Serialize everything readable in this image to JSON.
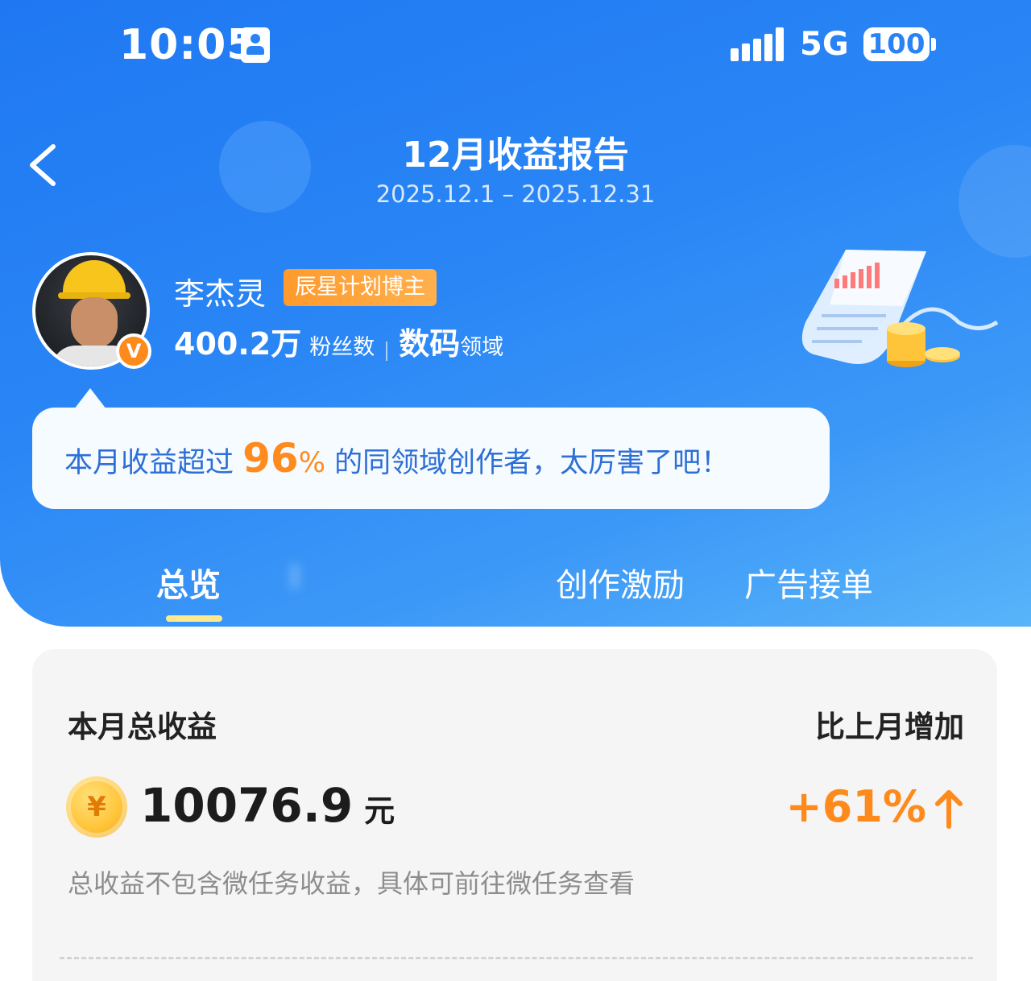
{
  "status_bar": {
    "time": "10:05",
    "network": "5G",
    "battery": "100"
  },
  "header": {
    "title": "12月收益报告",
    "date_range": "2025.12.1 – 2025.12.31",
    "back_icon": "chevron-left-icon"
  },
  "profile": {
    "name": "李杰灵",
    "tag": "辰星计划博主",
    "fans_count": "400.2万",
    "fans_label": "粉丝数",
    "field_name": "数码",
    "field_label": "领域",
    "verified_mark": "V"
  },
  "bubble": {
    "before": "本月收益超过 ",
    "percent": "96",
    "percent_sign": "%",
    "after": " 的同领域创作者，太厉害了吧！"
  },
  "tabs": [
    {
      "label": "总览",
      "active": true
    },
    {
      "label": "Ⅰ",
      "active": false,
      "blurred": true
    },
    {
      "label": "创作激励",
      "active": false
    },
    {
      "label": "广告接单",
      "active": false
    }
  ],
  "summary": {
    "title": "本月总收益",
    "compare_label": "比上月增加",
    "coin_symbol": "¥",
    "amount": "10076.9",
    "unit": "元",
    "growth": "+61%",
    "note": "总收益不包含微任务收益，具体可前往微任务查看"
  },
  "colors": {
    "primary_blue": "#2a83f4",
    "accent_orange": "#ff8a1c",
    "bubble_text": "#2d6fd6",
    "tab_underline": "#ffe98d"
  }
}
